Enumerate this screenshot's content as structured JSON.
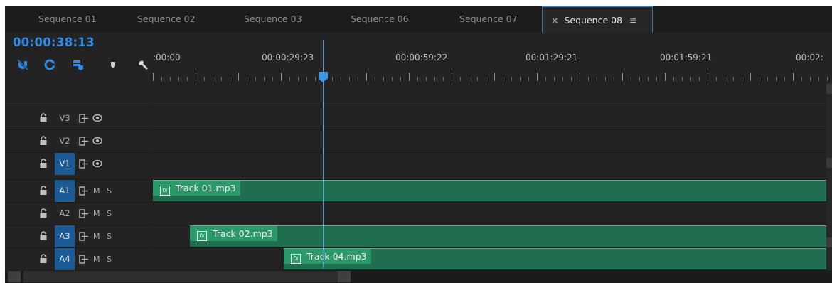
{
  "tabs": [
    {
      "label": "Sequence 01",
      "active": false
    },
    {
      "label": "Sequence 02",
      "active": false
    },
    {
      "label": "Sequence 03",
      "active": false
    },
    {
      "label": "Sequence 06",
      "active": false
    },
    {
      "label": "Sequence 07",
      "active": false
    },
    {
      "label": "Sequence 08",
      "active": true
    }
  ],
  "tab_close_glyph": "×",
  "tab_menu_glyph": "≡",
  "timecode": "00:00:38:13",
  "ruler": {
    "labels": [
      ":00:00",
      "00:00:29:23",
      "00:00:59:22",
      "00:01:29:21",
      "00:01:59:21",
      "00:02:"
    ]
  },
  "tools": [
    {
      "icon": "snap-icon"
    },
    {
      "icon": "linked-selection-icon"
    },
    {
      "icon": "add-marker-icon"
    },
    {
      "icon": "marker-icon"
    },
    {
      "icon": "wrench-icon"
    }
  ],
  "tracks": [
    {
      "label": "V3",
      "kind": "video",
      "selected": false
    },
    {
      "label": "V2",
      "kind": "video",
      "selected": false
    },
    {
      "label": "V1",
      "kind": "video",
      "selected": true
    },
    {
      "label": "A1",
      "kind": "audio",
      "selected": true
    },
    {
      "label": "A2",
      "kind": "audio",
      "selected": false
    },
    {
      "label": "A3",
      "kind": "audio",
      "selected": true
    },
    {
      "label": "A4",
      "kind": "audio",
      "selected": true
    }
  ],
  "audio_buttons": {
    "mute": "M",
    "solo": "S"
  },
  "clips": [
    {
      "name": "Track 01.mp3",
      "track": "A1",
      "fx": "fx"
    },
    {
      "name": "Track 02.mp3",
      "track": "A3",
      "fx": "fx"
    },
    {
      "name": "Track 04.mp3",
      "track": "A4",
      "fx": "fx"
    }
  ],
  "colors": {
    "timecode": "#2d8ceb",
    "clip": "#1f6e4f",
    "clip_header": "#2a9a6b",
    "track_selected": "#1a5a96",
    "playhead": "#4aa0ec"
  }
}
